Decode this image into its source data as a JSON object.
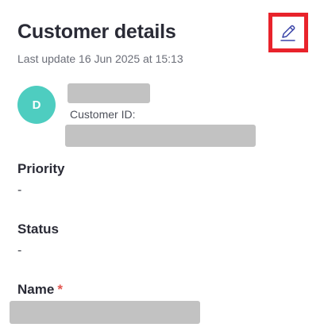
{
  "header": {
    "title": "Customer details",
    "last_update": "Last update 16 Jun 2025 at 15:13"
  },
  "customer": {
    "avatar_initial": "D",
    "customer_id_label": "Customer ID:"
  },
  "fields": {
    "priority": {
      "label": "Priority",
      "value": "-"
    },
    "status": {
      "label": "Status",
      "value": "-"
    },
    "name": {
      "label": "Name",
      "required_mark": "*"
    }
  },
  "icons": {
    "edit": "pencil-icon"
  },
  "colors": {
    "avatar_bg": "#4ecdc0",
    "edit_outline": "#e8232b",
    "required_mark": "#e2554f",
    "pencil_stroke": "#3a44a8"
  }
}
